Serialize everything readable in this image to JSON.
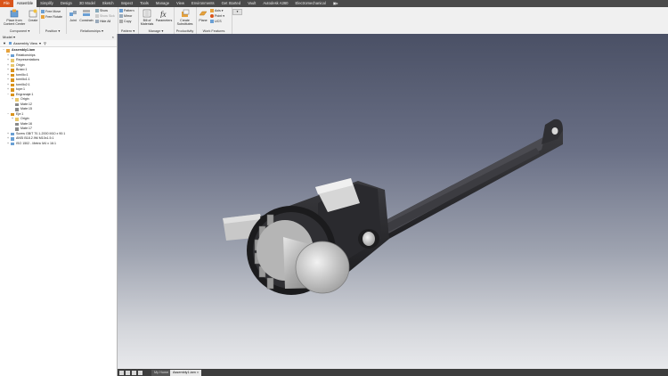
{
  "menu_tabs": [
    "File",
    "Assemble",
    "Simplify",
    "Design",
    "3D Model",
    "Sketch",
    "Inspect",
    "Tools",
    "Manage",
    "View",
    "Environments",
    "Get Started",
    "Vault",
    "Autodesk A360",
    "Electromechanical"
  ],
  "ribbon": {
    "component": {
      "title": "Component",
      "place_label": "Place from\nContent Center",
      "create_label": "Create"
    },
    "position": {
      "title": "Position",
      "free_move": "Free Move",
      "free_rotate": "Free Rotate"
    },
    "relationships": {
      "title": "Relationships",
      "joint": "Joint",
      "constrain": "Constrain",
      "show": "Show",
      "show_sick": "Show Sick",
      "hide_all": "Hide All"
    },
    "pattern": {
      "title": "Pattern",
      "pattern": "Pattern",
      "mirror": "Mirror",
      "copy": "Copy"
    },
    "manage": {
      "title": "Manage",
      "bom": "Bill of\nMaterials",
      "parameters": "Parameters"
    },
    "productivity": {
      "title": "Productivity",
      "create_substitutes": "Create\nSubstitutes"
    },
    "work_features": {
      "title": "Work Features",
      "plane": "Plane",
      "axis": "Axis",
      "point": "Point",
      "ucs": "UCS"
    }
  },
  "browser": {
    "title": "Model",
    "view_label": "Assembly View",
    "tree": [
      {
        "label": "Assembly1.iam",
        "level": 0,
        "exp": "−",
        "icon": "assembly",
        "root": true
      },
      {
        "label": "Relationships",
        "level": 1,
        "exp": "+",
        "icon": "relationships"
      },
      {
        "label": "Representations",
        "level": 1,
        "exp": "+",
        "icon": "folder"
      },
      {
        "label": "Origin",
        "level": 1,
        "exp": "+",
        "icon": "folder"
      },
      {
        "label": "Brazo:1",
        "level": 1,
        "exp": "+",
        "icon": "part"
      },
      {
        "label": "tornillo:1",
        "level": 1,
        "exp": "+",
        "icon": "part"
      },
      {
        "label": "tornillo1:1",
        "level": 1,
        "exp": "+",
        "icon": "part"
      },
      {
        "label": "tornillo2:1",
        "level": 1,
        "exp": "+",
        "icon": "part"
      },
      {
        "label": "tope:1",
        "level": 1,
        "exp": "+",
        "icon": "part"
      },
      {
        "label": "Engranaje:1",
        "level": 1,
        "exp": "−",
        "icon": "part"
      },
      {
        "label": "Origin",
        "level": 2,
        "exp": "+",
        "icon": "folder"
      },
      {
        "label": "Mate:12",
        "level": 2,
        "exp": "",
        "icon": "mate"
      },
      {
        "label": "Mate:15",
        "level": 2,
        "exp": "",
        "icon": "mate"
      },
      {
        "label": "Eje:1",
        "level": 1,
        "exp": "−",
        "icon": "part"
      },
      {
        "label": "Origin",
        "level": 2,
        "exp": "+",
        "icon": "folder"
      },
      {
        "label": "Mate:16",
        "level": 2,
        "exp": "",
        "icon": "mate"
      },
      {
        "label": "Mate:17",
        "level": 2,
        "exp": "",
        "icon": "mate"
      },
      {
        "label": "Screw GB/T 70.1-2000 M10 x 90:1",
        "level": 1,
        "exp": "+",
        "icon": "screw"
      },
      {
        "label": "ANSI B18.2.9M M10x1.5:1",
        "level": 1,
        "exp": "+",
        "icon": "screw"
      },
      {
        "label": "ISO 1502 - Metric M4 x 16:1",
        "level": 1,
        "exp": "+",
        "icon": "screw"
      }
    ]
  },
  "doc_tabs": {
    "home": "My Home",
    "active": "Assembly1.iam"
  },
  "colors": {
    "file_tab": "#d9541a",
    "tab_bar": "#4a4a4a",
    "viewport_top": "#4a5065",
    "viewport_bottom": "#e8e9ec",
    "part_dark": "#2b2b2e",
    "metal": "#b8b8b8"
  }
}
